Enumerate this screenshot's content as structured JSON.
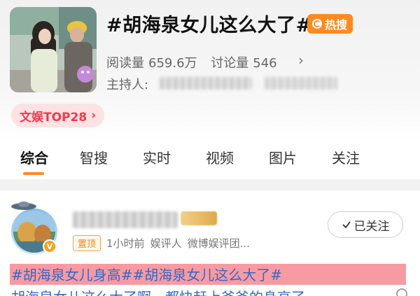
{
  "topic": {
    "title": "#胡海泉女儿这么大了#",
    "hot_badge": "热搜",
    "reads_label": "阅读量",
    "reads_value": "659.6万",
    "discussions_label": "讨论量",
    "discussions_value": "546",
    "host_label": "主持人:",
    "rank_chip": "文娱TOP28"
  },
  "tabs": [
    {
      "label": "综合"
    },
    {
      "label": "智搜"
    },
    {
      "label": "实时"
    },
    {
      "label": "视频"
    },
    {
      "label": "图片"
    },
    {
      "label": "关注"
    }
  ],
  "post": {
    "pin_label": "置顶",
    "time": "1小时前",
    "role": "娱评人",
    "org": "微博娱评团...",
    "follow_label": "已关注",
    "text_line1": "#胡海泉女儿身高##胡海泉女儿这么大了#",
    "text_line2": "胡海泉女儿这么大了啊，都快赶上爸爸的身高了"
  },
  "colors": {
    "accent": "#ff8a1f",
    "rank_text": "#f03a4c",
    "link_blue": "#3369c8",
    "highlight": "#f89aa1"
  }
}
